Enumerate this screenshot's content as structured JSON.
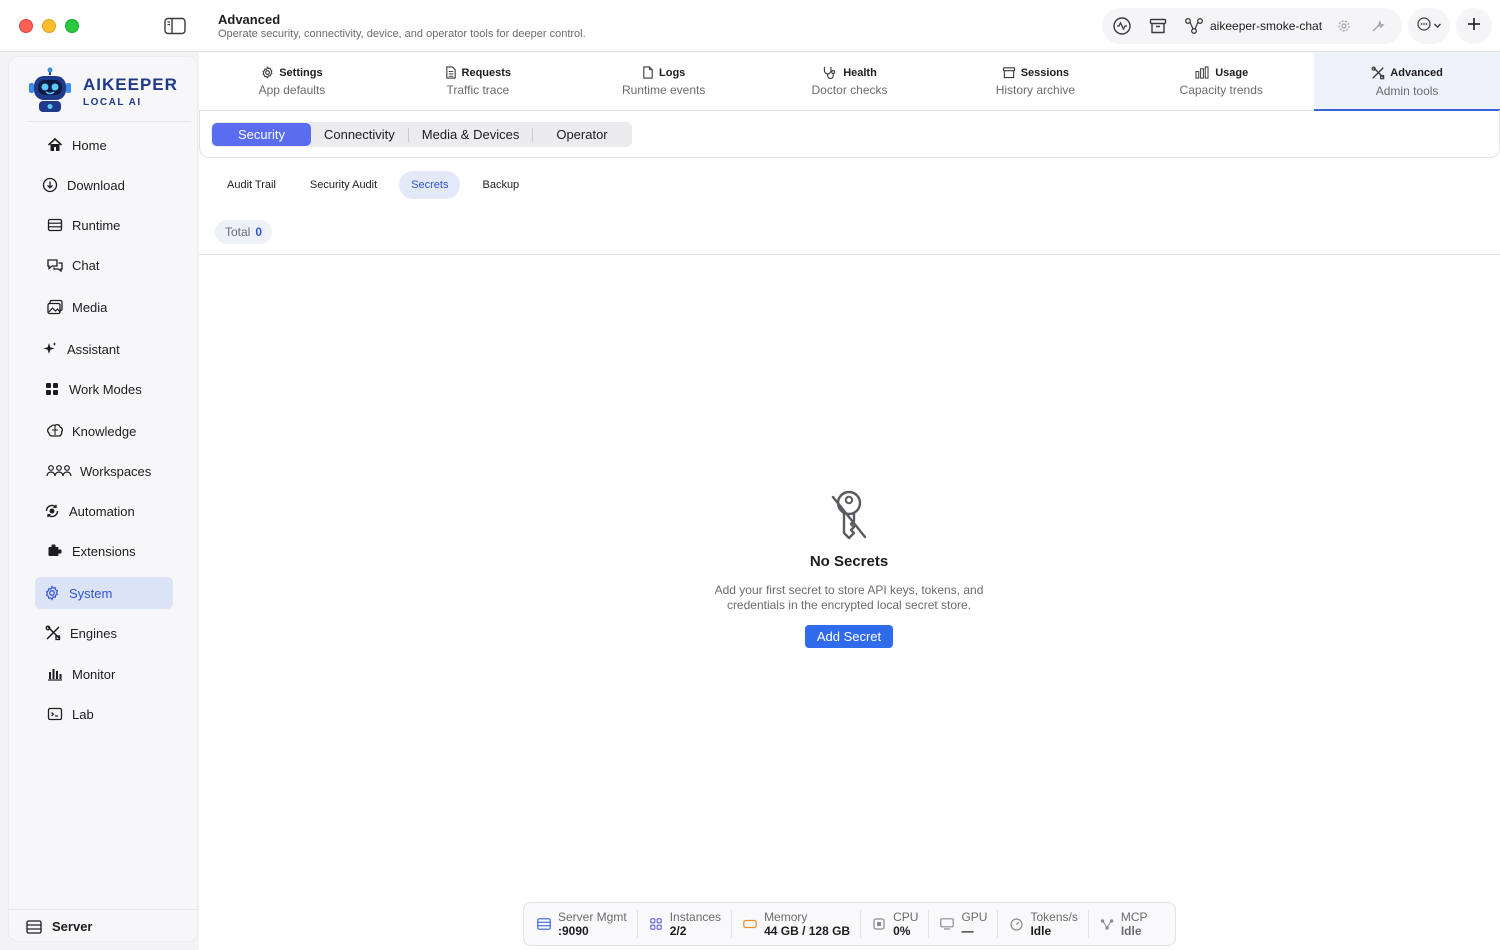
{
  "header": {
    "title": "Advanced",
    "subtitle": "Operate security, connectivity, device, and operator tools for deeper control.",
    "workspace_name": "aikeeper-smoke-chat"
  },
  "brand": {
    "name": "AIKEEPER",
    "tagline": "LOCAL AI"
  },
  "sidebar": {
    "items": [
      {
        "label": "Home",
        "icon": "home-icon"
      },
      {
        "label": "Download",
        "icon": "download-icon"
      },
      {
        "label": "Runtime",
        "icon": "runtime-icon"
      },
      {
        "label": "Chat",
        "icon": "chat-icon"
      },
      {
        "label": "Media",
        "icon": "media-icon"
      },
      {
        "label": "Assistant",
        "icon": "sparkle-icon"
      },
      {
        "label": "Work Modes",
        "icon": "grid-icon"
      },
      {
        "label": "Knowledge",
        "icon": "brain-icon"
      },
      {
        "label": "Workspaces",
        "icon": "people-icon"
      },
      {
        "label": "Automation",
        "icon": "automation-icon"
      },
      {
        "label": "Extensions",
        "icon": "plugin-icon"
      },
      {
        "label": "System",
        "icon": "gear-icon"
      },
      {
        "label": "Engines",
        "icon": "tools-icon"
      },
      {
        "label": "Monitor",
        "icon": "bar-chart-icon"
      },
      {
        "label": "Lab",
        "icon": "terminal-icon"
      }
    ],
    "active": "System",
    "footer_label": "Server"
  },
  "tabs": [
    {
      "label": "Settings",
      "sub": "App defaults",
      "icon": "gear-icon"
    },
    {
      "label": "Requests",
      "sub": "Traffic trace",
      "icon": "document-list-icon"
    },
    {
      "label": "Logs",
      "sub": "Runtime events",
      "icon": "document-icon"
    },
    {
      "label": "Health",
      "sub": "Doctor checks",
      "icon": "stethoscope-icon"
    },
    {
      "label": "Sessions",
      "sub": "History archive",
      "icon": "archive-icon"
    },
    {
      "label": "Usage",
      "sub": "Capacity trends",
      "icon": "bar-chart-icon"
    },
    {
      "label": "Advanced",
      "sub": "Admin tools",
      "icon": "tools-icon"
    }
  ],
  "segments": [
    "Security",
    "Connectivity",
    "Media & Devices",
    "Operator"
  ],
  "subtabs": [
    "Audit Trail",
    "Security Audit",
    "Secrets",
    "Backup"
  ],
  "total": {
    "label": "Total",
    "value": "0"
  },
  "empty": {
    "title": "No Secrets",
    "desc_line1": "Add your first secret to store API keys, tokens, and",
    "desc_line2": "credentials in the encrypted local secret store.",
    "button": "Add Secret"
  },
  "status": [
    {
      "label": "Server Mgmt",
      "value": ":9090",
      "icon": "server-icon",
      "color": "#3a63e0"
    },
    {
      "label": "Instances",
      "value": "2/2",
      "icon": "instances-icon",
      "color": "#5a5fd8"
    },
    {
      "label": "Memory",
      "value": "44 GB / 128 GB",
      "icon": "memory-icon",
      "color": "#f0902a"
    },
    {
      "label": "CPU",
      "value": "0%",
      "icon": "cpu-icon",
      "color": "#8a8a90"
    },
    {
      "label": "GPU",
      "value": "—",
      "icon": "gpu-icon",
      "color": "#8a8a90"
    },
    {
      "label": "Tokens/s",
      "value": "Idle",
      "icon": "gauge-icon",
      "color": "#8a8a90"
    },
    {
      "label": "MCP",
      "value": "Idle",
      "icon": "network-icon",
      "color": "#8a8a90"
    }
  ],
  "colors": {
    "accent": "#2f6bea",
    "active_segment": "#5a6cf0",
    "brand": "#1f3a8a"
  }
}
